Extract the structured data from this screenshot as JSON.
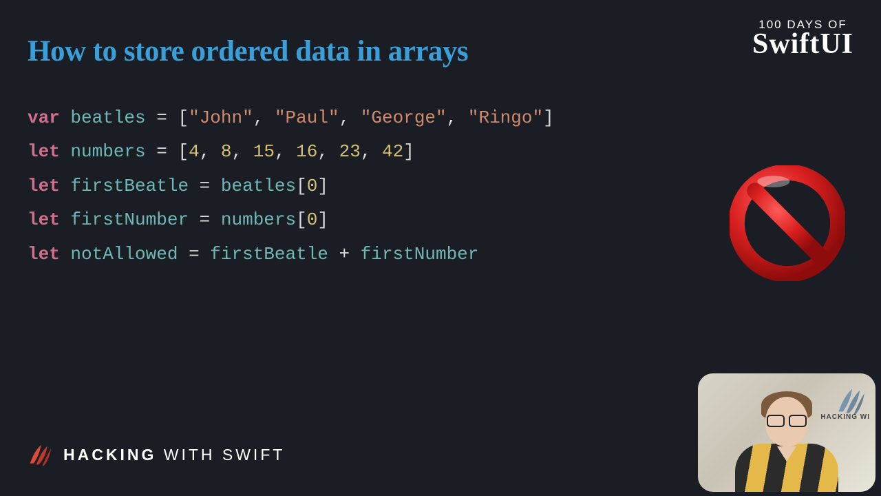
{
  "title": "How to store ordered data in arrays",
  "top_logo": {
    "line1": "100 DAYS OF",
    "line2": "SwiftUI"
  },
  "bottom_logo": {
    "strong": "HACKING",
    "rest": " WITH SWIFT"
  },
  "webcam_banner": "HACKING WI",
  "code": {
    "l1": {
      "kw": "var",
      "name": "beatles",
      "vals": [
        "John",
        "Paul",
        "George",
        "Ringo"
      ]
    },
    "l2": {
      "kw": "let",
      "name": "numbers",
      "vals": [
        4,
        8,
        15,
        16,
        23,
        42
      ]
    },
    "l3": {
      "kw": "let",
      "name": "firstBeatle",
      "src": "beatles",
      "idx": 0
    },
    "l4": {
      "kw": "let",
      "name": "firstNumber",
      "src": "numbers",
      "idx": 0
    },
    "l5": {
      "kw": "let",
      "name": "notAllowed",
      "a": "firstBeatle",
      "b": "firstNumber"
    }
  }
}
